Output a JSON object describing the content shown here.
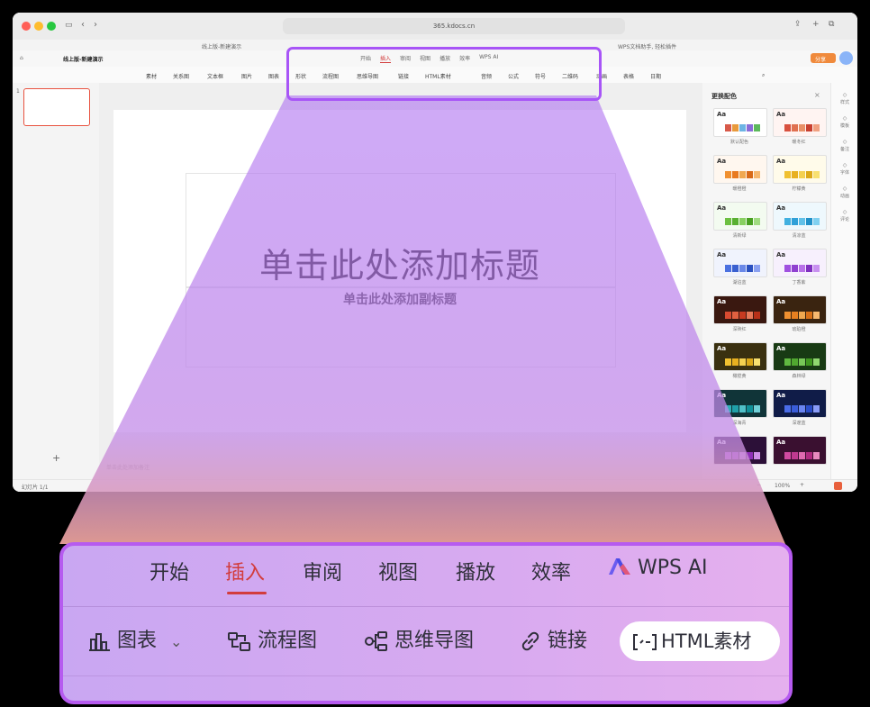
{
  "browser": {
    "url": "365.kdocs.cn",
    "tab_label": "线上版-新建演示",
    "extension_notice": "WPS文档助手, 轻松插件"
  },
  "app": {
    "doc_title": "线上版-新建演示",
    "mini_tabs": [
      "开始",
      "插入",
      "审阅",
      "视图",
      "播放",
      "效率",
      "WPS AI"
    ],
    "toolbar_items": [
      "素材",
      "关系图",
      "文本框",
      "图片",
      "图表",
      "形状",
      "流程图",
      "思维导图",
      "链接",
      "HTML素材",
      "音频",
      "公式",
      "符号",
      "二维码",
      "动画",
      "表格",
      "日期"
    ],
    "share_label": "分享"
  },
  "slide": {
    "title_placeholder": "单击此处添加标题",
    "subtitle_placeholder": "单击此处添加副标题",
    "notes_placeholder": "单击此处添加备注"
  },
  "theme_panel": {
    "title": "更换配色",
    "themes": [
      {
        "name": "默认配色",
        "bg": "#ffffff",
        "aa": "#333333",
        "bars": [
          "#d85a4a",
          "#e89a3c",
          "#6cb4e4",
          "#8a6cd8",
          "#5cb85c"
        ]
      },
      {
        "name": "暖冬红",
        "bg": "#fff4f2",
        "aa": "#333333",
        "bars": [
          "#d8503e",
          "#e07050",
          "#e89068",
          "#c84030",
          "#f0a080"
        ]
      },
      {
        "name": "暖橙橙",
        "bg": "#fff7ef",
        "aa": "#333333",
        "bars": [
          "#f09030",
          "#e87a20",
          "#f0a850",
          "#d86a18",
          "#f6b870"
        ]
      },
      {
        "name": "柠檬黄",
        "bg": "#fffbea",
        "aa": "#333333",
        "bars": [
          "#f0c030",
          "#e8b020",
          "#f4d050",
          "#dca818",
          "#f8e070"
        ]
      },
      {
        "name": "清新绿",
        "bg": "#f3fbf0",
        "aa": "#333333",
        "bars": [
          "#6cc040",
          "#58b030",
          "#88d060",
          "#48a020",
          "#a0dc80"
        ]
      },
      {
        "name": "清凉蓝",
        "bg": "#eef8fd",
        "aa": "#333333",
        "bars": [
          "#40b0e0",
          "#30a0d8",
          "#60c0e8",
          "#2090c8",
          "#80d0f0"
        ]
      },
      {
        "name": "湖泊蓝",
        "bg": "#f0f3fd",
        "aa": "#333333",
        "bars": [
          "#4a70e0",
          "#3a60d0",
          "#6a88e8",
          "#2a50c0",
          "#8aa0f0"
        ]
      },
      {
        "name": "丁香紫",
        "bg": "#f7f0fd",
        "aa": "#333333",
        "bars": [
          "#a050e0",
          "#9040d0",
          "#b870e8",
          "#8030c0",
          "#c890f0"
        ]
      },
      {
        "name": "深砖红",
        "bg": "#3a1810",
        "aa": "#ffffff",
        "bars": [
          "#d84a30",
          "#e06040",
          "#c83a20",
          "#e87858",
          "#b83018"
        ]
      },
      {
        "name": "琥珀橙",
        "bg": "#3a2410",
        "aa": "#ffffff",
        "bars": [
          "#f09030",
          "#e88020",
          "#f0a850",
          "#d87018",
          "#f6b870"
        ]
      },
      {
        "name": "橄榄黄",
        "bg": "#3a3010",
        "aa": "#ffffff",
        "bars": [
          "#f0c030",
          "#e8b020",
          "#f4d050",
          "#dca818",
          "#f8e070"
        ]
      },
      {
        "name": "森林绿",
        "bg": "#183a14",
        "aa": "#ffffff",
        "bars": [
          "#60b840",
          "#50a830",
          "#78c858",
          "#409820",
          "#90d870"
        ]
      },
      {
        "name": "深海青",
        "bg": "#103438",
        "aa": "#ffffff",
        "bars": [
          "#30b0b8",
          "#20a0a8",
          "#50c0c8",
          "#109098",
          "#70d0d8"
        ]
      },
      {
        "name": "深邃蓝",
        "bg": "#101c48",
        "aa": "#ffffff",
        "bars": [
          "#4a6ce8",
          "#3a5cd8",
          "#6a84f0",
          "#2a4cc8",
          "#8a9cf8"
        ]
      },
      {
        "name": "",
        "bg": "#2c1038",
        "aa": "#ffffff",
        "bars": [
          "#b050d8",
          "#a040c8",
          "#c070e0",
          "#9030b8",
          "#d090e8"
        ]
      },
      {
        "name": "",
        "bg": "#3a1030",
        "aa": "#ffffff",
        "bars": [
          "#d04aa0",
          "#c03a90",
          "#e06ab0",
          "#b02a80",
          "#e88ac0"
        ]
      }
    ]
  },
  "side_strip": [
    "样式",
    "模板",
    "备注",
    "字体",
    "动画",
    "评论"
  ],
  "status": {
    "page": "幻灯片 1/1",
    "zoom": "100%"
  },
  "zoom_ribbon": {
    "tabs": [
      {
        "label": "开始",
        "active": false
      },
      {
        "label": "插入",
        "active": true
      },
      {
        "label": "审阅",
        "active": false
      },
      {
        "label": "视图",
        "active": false
      },
      {
        "label": "播放",
        "active": false
      },
      {
        "label": "效率",
        "active": false
      }
    ],
    "ai_tab": "WPS AI",
    "tools": {
      "chart": "图表",
      "flowchart": "流程图",
      "mindmap": "思维导图",
      "link": "链接",
      "html": "HTML素材"
    },
    "colors": {
      "active_tab": "#d23c3c",
      "highlight_border": "#b65bf0"
    }
  }
}
